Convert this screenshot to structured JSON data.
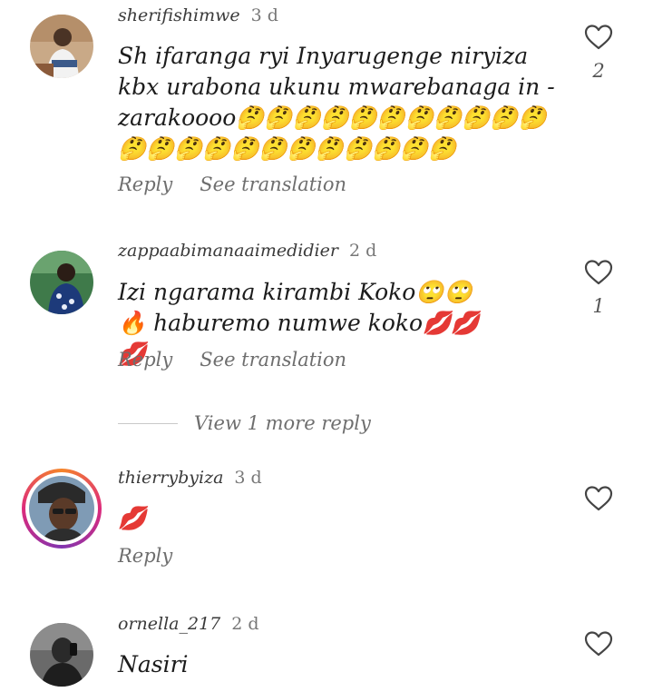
{
  "actions": {
    "reply_label": "Reply",
    "translate_label": "See translation",
    "view_more_label": "View 1 more reply"
  },
  "icons": {
    "like": "heart-outline-icon"
  },
  "comments": [
    {
      "username": "sherifishimwe",
      "time": "3 d",
      "text": "Sh ifaranga ryi Inyarugenge niryiza kbx urabona ukunu mwarebanaga in -zarakoooo🤔🤔🤔🤔🤔🤔🤔🤔🤔🤔🤔🤔🤔🤔🤔🤔🤔🤔🤔🤔🤔🤔🤔",
      "likes": "2",
      "has_translation": true
    },
    {
      "username": "zappaabimanaaimedidier",
      "time": "2 d",
      "text": "Izi ngarama kirambi Koko🙄🙄🔥 haburemo numwe koko💋💋💋",
      "likes": "1",
      "has_translation": true
    },
    {
      "username": "thierrybyiza",
      "time": "3 d",
      "text": "💋",
      "likes": "",
      "has_translation": false
    },
    {
      "username": "ornella_217",
      "time": "2 d",
      "text": "Nasiri",
      "likes": "",
      "has_translation": false
    }
  ],
  "colors": {
    "story_ring_start": "#f58529",
    "story_ring_mid": "#dd2a7b",
    "text": "#1c1c1c",
    "muted": "#6e6e6e"
  }
}
